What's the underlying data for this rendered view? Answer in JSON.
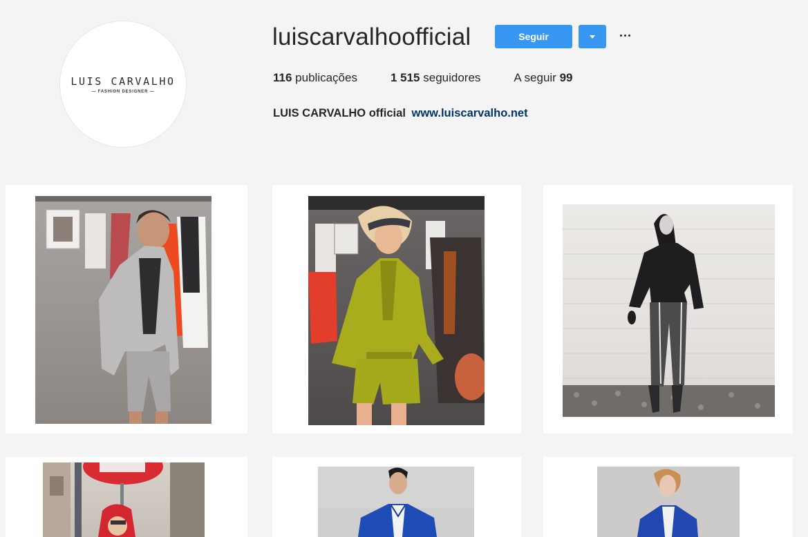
{
  "profile": {
    "username": "luiscarvalhoofficial",
    "logo_main": "LUIS CARVALHO",
    "logo_sub": "— FASHION DESIGNER —",
    "follow_label": "Seguir",
    "posts_count": "116",
    "posts_label": "publicações",
    "followers_count": "1 515",
    "followers_label": "seguidores",
    "following_label": "A seguir",
    "following_count": "99",
    "bio_name": "LUIS CARVALHO official",
    "bio_link": "www.luiscarvalho.net"
  },
  "colors": {
    "accent": "#3897f0",
    "link": "#003569",
    "background": "#f4f4f4"
  },
  "icons": {
    "dropdown": "chevron-down-icon",
    "more": "more-options-icon"
  },
  "posts": [
    {
      "subject": "model-grey-suit"
    },
    {
      "subject": "model-chartreuse-suit"
    },
    {
      "subject": "model-black-jacket"
    },
    {
      "subject": "model-street-red"
    },
    {
      "subject": "model-blue-suit-male"
    },
    {
      "subject": "model-blue-suit-female"
    }
  ]
}
